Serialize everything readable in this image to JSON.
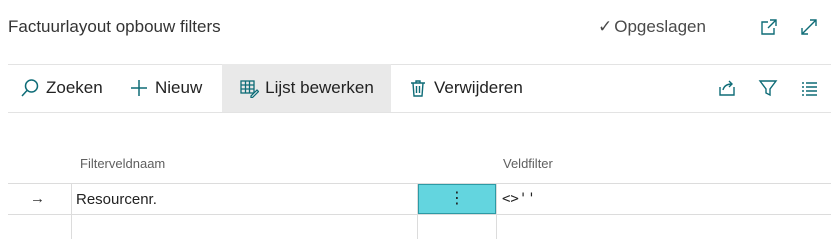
{
  "header": {
    "title": "Factuurlayout opbouw filters",
    "saved_status": "Opgeslagen",
    "icons": [
      "check-icon",
      "open-in-new-window-icon",
      "expand-icon"
    ]
  },
  "toolbar": {
    "search_label": "Zoeken",
    "new_label": "Nieuw",
    "edit_list_label": "Lijst bewerken",
    "delete_label": "Verwijderen",
    "right_icons": [
      "share-icon",
      "filter-icon",
      "list-view-icon"
    ]
  },
  "table": {
    "columns": [
      "Filterveldnaam",
      "Veldfilter"
    ],
    "rows": [
      {
        "indicator": "→",
        "field_name": "Resourcenr.",
        "assist": "⋮",
        "field_filter": "<>''"
      }
    ]
  },
  "colors": {
    "accent_cell": "#63d5df",
    "accent_border": "#2c9aa5",
    "icon_teal": "#0e6c77",
    "active_button_bg": "#e9e9e9"
  }
}
